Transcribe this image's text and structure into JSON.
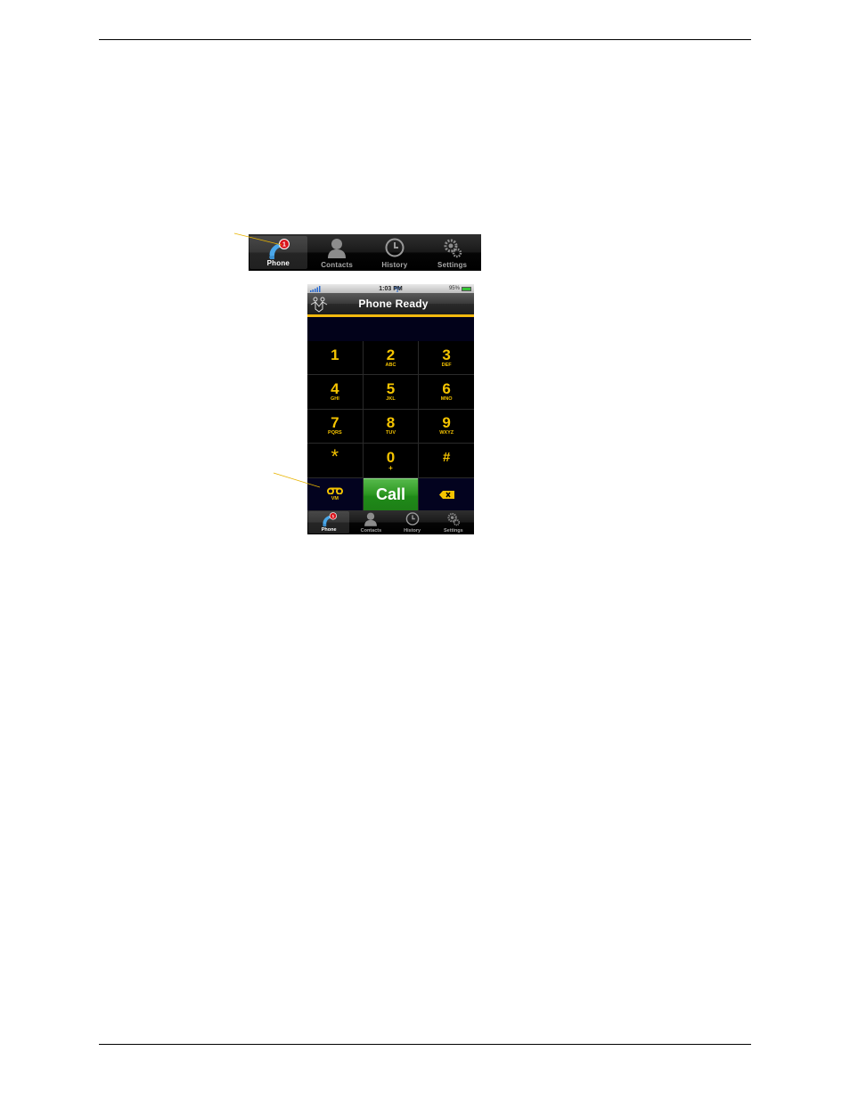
{
  "document": {
    "figure": "Phone tab and VM button callouts"
  },
  "tabbar_callout": {
    "tabs": [
      {
        "label": "Phone",
        "icon": "phone-handset-icon",
        "active": true,
        "badge": "1"
      },
      {
        "label": "Contacts",
        "icon": "person-icon",
        "active": false
      },
      {
        "label": "History",
        "icon": "clock-icon",
        "active": false
      },
      {
        "label": "Settings",
        "icon": "gears-icon",
        "active": false
      }
    ]
  },
  "phone": {
    "statusbar": {
      "signal_icon": "signal-bars-icon",
      "wifi_icon": "wifi-icon",
      "time": "1:03 PM",
      "battery": "95%",
      "battery_level": 0.95
    },
    "navbar": {
      "logo": "people-logo-icon",
      "title": "Phone Ready"
    },
    "display_value": "",
    "keypad": [
      {
        "digit": "1",
        "letters": ""
      },
      {
        "digit": "2",
        "letters": "ABC"
      },
      {
        "digit": "3",
        "letters": "DEF"
      },
      {
        "digit": "4",
        "letters": "GHI"
      },
      {
        "digit": "5",
        "letters": "JKL"
      },
      {
        "digit": "6",
        "letters": "MNO"
      },
      {
        "digit": "7",
        "letters": "PQRS"
      },
      {
        "digit": "8",
        "letters": "TUV"
      },
      {
        "digit": "9",
        "letters": "WXYZ"
      },
      {
        "digit": "*",
        "letters": ""
      },
      {
        "digit": "0",
        "letters": "+"
      },
      {
        "digit": "#",
        "letters": ""
      }
    ],
    "actions": {
      "vm_label": "VM",
      "vm_icon": "voicemail-icon",
      "call_label": "Call",
      "delete_icon": "backspace-icon"
    },
    "tabbar": {
      "tabs": [
        {
          "label": "Phone",
          "active": true,
          "badge": "1"
        },
        {
          "label": "Contacts",
          "active": false
        },
        {
          "label": "History",
          "active": false
        },
        {
          "label": "Settings",
          "active": false
        }
      ]
    }
  },
  "colors": {
    "accent_yellow": "#f5c400",
    "call_green": "#2f9a24",
    "badge_red": "#d9141c",
    "callout_line": "#e8b400"
  }
}
